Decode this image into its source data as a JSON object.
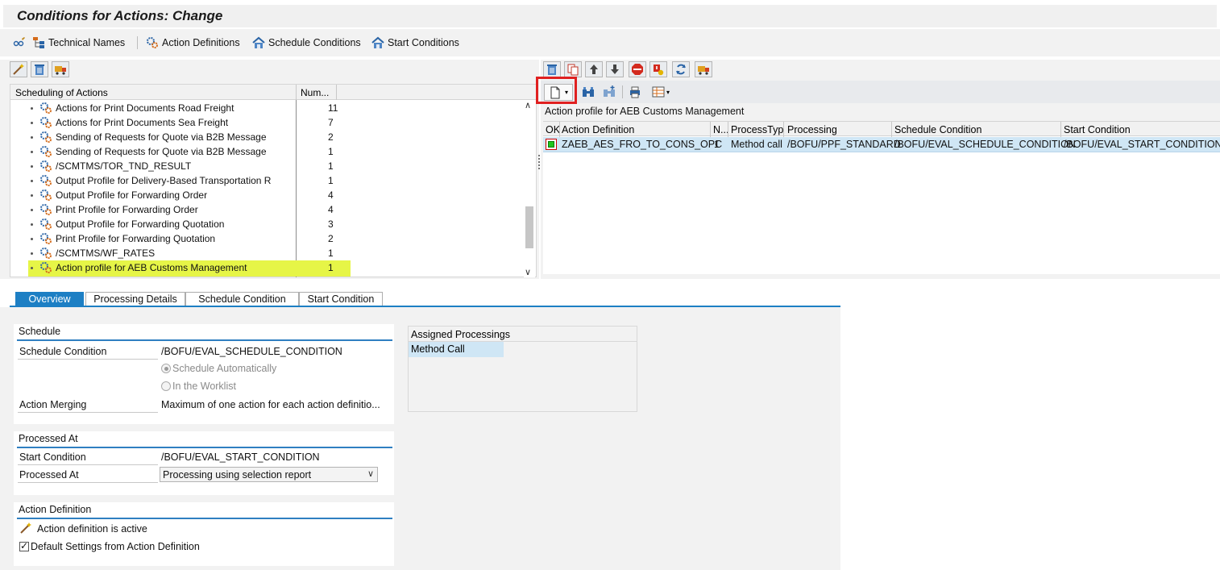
{
  "window": {
    "title": "Conditions for Actions: Change"
  },
  "toolbar": {
    "technical_names": "Technical Names",
    "action_definitions": "Action Definitions",
    "schedule_conditions": "Schedule Conditions",
    "start_conditions": "Start Conditions"
  },
  "tree": {
    "col_name": "Scheduling of Actions",
    "col_num": "Num...",
    "items": [
      {
        "label": "Actions for Print Documents Road Freight",
        "num": "11"
      },
      {
        "label": "Actions for Print Documents Sea Freight",
        "num": "7"
      },
      {
        "label": "Sending of Requests for Quote via B2B Message",
        "num": "2"
      },
      {
        "label": "Sending of Requests for Quote via B2B Message",
        "num": "1"
      },
      {
        "label": "/SCMTMS/TOR_TND_RESULT",
        "num": "1"
      },
      {
        "label": "Output Profile for Delivery-Based Transportation R",
        "num": "1"
      },
      {
        "label": "Output Profile for Forwarding Order",
        "num": "4"
      },
      {
        "label": "Print Profile for Forwarding Order",
        "num": "4"
      },
      {
        "label": "Output Profile for Forwarding Quotation",
        "num": "3"
      },
      {
        "label": "Print Profile for Forwarding Quotation",
        "num": "2"
      },
      {
        "label": "/SCMTMS/WF_RATES",
        "num": "1"
      },
      {
        "label": "Action profile for AEB Customs Management",
        "num": "1"
      }
    ],
    "selected_index": 11
  },
  "right": {
    "title": "Action profile for AEB Customs Management",
    "columns": [
      "OK",
      "Action Definition",
      "N...",
      "ProcessTyp",
      "Processing",
      "Schedule Condition",
      "Start Condition"
    ],
    "row": {
      "action_definition": "ZAEB_AES_FRO_TO_CONS_OPC",
      "n": "1",
      "process_type": "Method call",
      "processing": "/BOFU/PPF_STANDARD",
      "schedule_condition": "/BOFU/EVAL_SCHEDULE_CONDITION",
      "start_condition": "/BOFU/EVAL_START_CONDITION"
    }
  },
  "tabs": [
    "Overview",
    "Processing Details",
    "Schedule Condition",
    "Start Condition"
  ],
  "active_tab": 0,
  "schedule": {
    "heading": "Schedule",
    "schedule_condition_label": "Schedule Condition",
    "schedule_condition_value": "/BOFU/EVAL_SCHEDULE_CONDITION",
    "radio_auto": "Schedule Automatically",
    "radio_worklist": "In the Worklist",
    "merging_label": "Action Merging",
    "merging_value": "Maximum of one action for each action definitio..."
  },
  "processed_at": {
    "heading": "Processed At",
    "start_condition_label": "Start Condition",
    "start_condition_value": "/BOFU/EVAL_START_CONDITION",
    "processed_at_label": "Processed At",
    "processed_at_value": "Processing using selection report"
  },
  "action_definition": {
    "heading": "Action Definition",
    "active_text": "Action definition is active",
    "default_settings": "Default Settings from Action Definition"
  },
  "assigned": {
    "heading": "Assigned Processings",
    "item": "Method Call"
  },
  "colors": {
    "accent": "#1d7fc4",
    "selection": "#cfe6f5",
    "tree_highlight": "#e6f547",
    "red_frame": "#e02020"
  }
}
